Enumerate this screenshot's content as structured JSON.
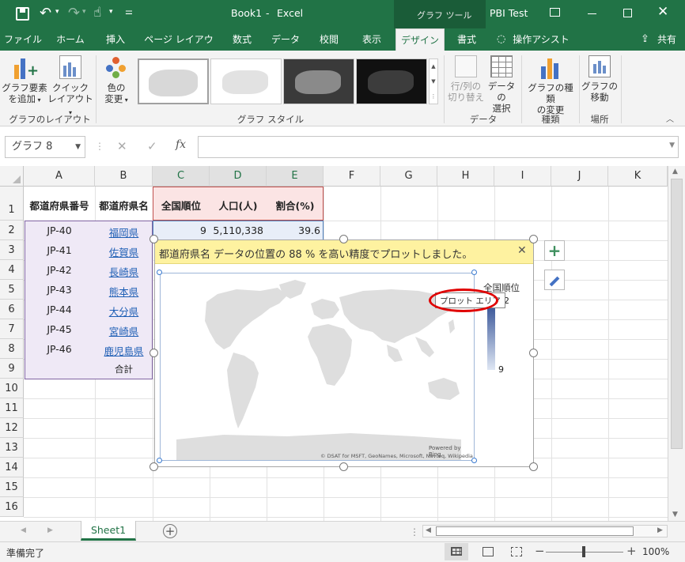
{
  "title": {
    "book": "Book1",
    "sep": "-",
    "app": "Excel",
    "context_tool": "グラフ ツール",
    "account": "PBI Test"
  },
  "qat": {
    "undo": "↶",
    "redo": "↷",
    "touch": "☝"
  },
  "tabs": [
    "ファイル",
    "ホーム",
    "挿入",
    "ページ レイアウト",
    "数式",
    "データ",
    "校閲",
    "表示",
    "デザイン",
    "書式"
  ],
  "tell_me": "操作アシスト",
  "share": "共有",
  "ribbon": {
    "add_element": [
      "グラフ要素",
      "を追加"
    ],
    "quick_layout": [
      "クイック",
      "レイアウト"
    ],
    "change_colors": [
      "色の",
      "変更"
    ],
    "switch_row_col": [
      "行/列の",
      "切り替え"
    ],
    "select_data": [
      "データの",
      "選択"
    ],
    "change_type": [
      "グラフの種類",
      "の変更"
    ],
    "move_chart": [
      "グラフの",
      "移動"
    ],
    "groups": {
      "layout": "グラフのレイアウト",
      "styles": "グラフ スタイル",
      "data": "データ",
      "type": "種類",
      "location": "場所"
    }
  },
  "formula_bar": {
    "name_box": "グラフ 8",
    "fx": "fx",
    "content": ""
  },
  "columns": [
    "A",
    "B",
    "C",
    "D",
    "E",
    "F",
    "G",
    "H",
    "I",
    "J",
    "K"
  ],
  "rows": [
    "1",
    "2",
    "3",
    "4",
    "5",
    "6",
    "7",
    "8",
    "9",
    "10",
    "11",
    "12",
    "13",
    "14",
    "15",
    "16"
  ],
  "table": {
    "headers": [
      "都道府県番号",
      "都道府県名",
      "全国順位",
      "人口(人)",
      "割合(%)"
    ],
    "codes": [
      "JP-40",
      "JP-41",
      "JP-42",
      "JP-43",
      "JP-44",
      "JP-45",
      "JP-46"
    ],
    "names": [
      "福岡県",
      "佐賀県",
      "長崎県",
      "熊本県",
      "大分県",
      "宮崎県",
      "鹿児島県"
    ],
    "total": "合計",
    "row2": {
      "rank": "9",
      "population": "5,110,338",
      "ratio": "39.6"
    }
  },
  "chart": {
    "notice": "都道府県名 データの位置の 88 % を高い精度でプロットしました。",
    "legend_title": "全国順位",
    "legend_max": "42",
    "legend_min": "9",
    "plot_area_tooltip": "プロット エリア",
    "powered_by": "Powered by Bing",
    "attribution": "© DSAT for MSFT, GeoNames, Microsoft, Navteq, Wikipedia"
  },
  "sheet_tab": "Sheet1",
  "status": {
    "ready": "準備完了",
    "zoom": "100%"
  },
  "colors": {
    "excel_green": "#217346",
    "link": "#1f5fb5",
    "highlight_red": "#e00000"
  }
}
